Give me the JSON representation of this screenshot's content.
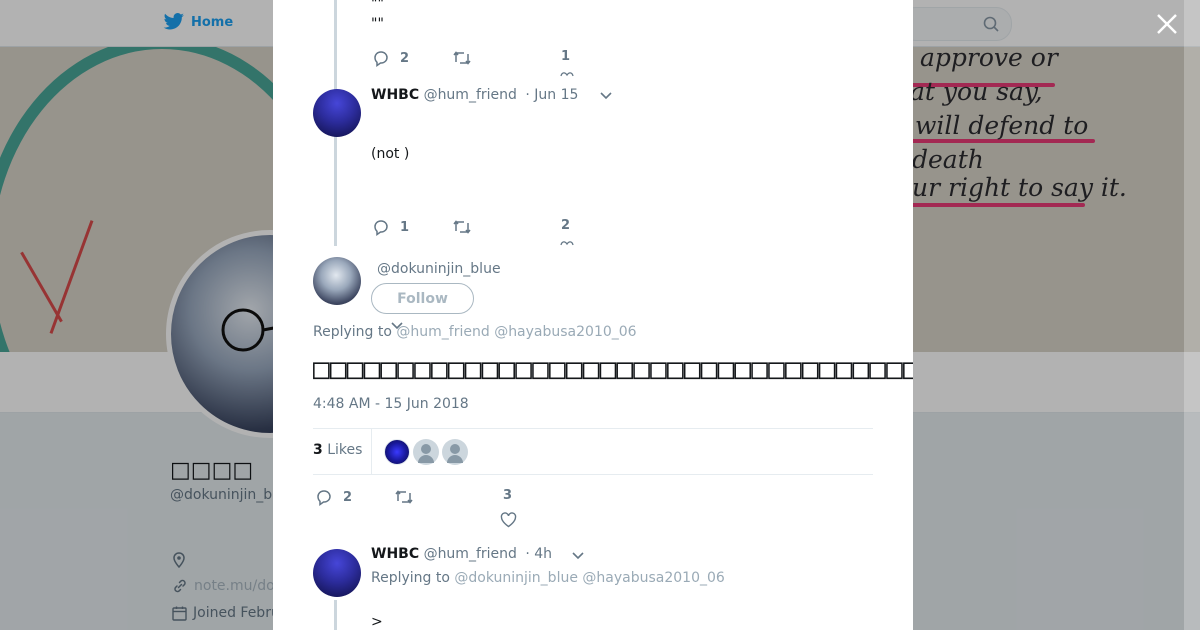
{
  "nav": {
    "home_label": "Home"
  },
  "profile": {
    "name": "□□□□",
    "handle": "@dokuninjin_b",
    "website": "note.mu/do",
    "joined": "Joined Febru"
  },
  "banner": {
    "lines": [
      "approve or",
      "at you say,",
      "will defend to",
      "death",
      "ur right to say it."
    ]
  },
  "modal": {
    "quote_line_1": "\"\"",
    "quote_line_2": "\"\"",
    "tweet1_actions": {
      "replies": "2",
      "likes": "1"
    },
    "tweet2": {
      "name": "WHBC",
      "handle": "@hum_friend",
      "time": "· Jun 15",
      "text": "(not )",
      "replies": "1",
      "likes": "2"
    },
    "main": {
      "handle": "@dokuninjin_blue",
      "follow_label": "Follow",
      "replying_prefix": "Replying to",
      "replying_to_1": "@hum_friend",
      "replying_to_2": "@hayabusa2010_06",
      "text": "□□□□□□□□□□□□□□□□□□□□□□□□□□□□□□□□□□□□□□□□□□□□□□□□□□□□□□□□□□□□□□□□□□□□",
      "timestamp": "4:48 AM - 15 Jun 2018",
      "likes_count": "3",
      "likes_label": "Likes",
      "replies": "2",
      "likes": "3"
    },
    "reply": {
      "name": "WHBC",
      "handle": "@hum_friend",
      "time": "· 4h",
      "replying_prefix": "Replying to",
      "replying_to_1": "@dokuninjin_blue",
      "replying_to_2": "@hayabusa2010_06",
      "text": ">"
    }
  },
  "colors": {
    "accent": "#1da1f2",
    "text": "#14171a",
    "muted": "#657786",
    "pink": "#ea3c78",
    "teal": "#2f9d8f"
  },
  "icons": [
    "home-bird-icon",
    "search-icon",
    "close-icon",
    "reply-icon",
    "retweet-icon",
    "like-icon",
    "chevron-down-icon",
    "location-icon",
    "link-icon",
    "calendar-icon"
  ]
}
